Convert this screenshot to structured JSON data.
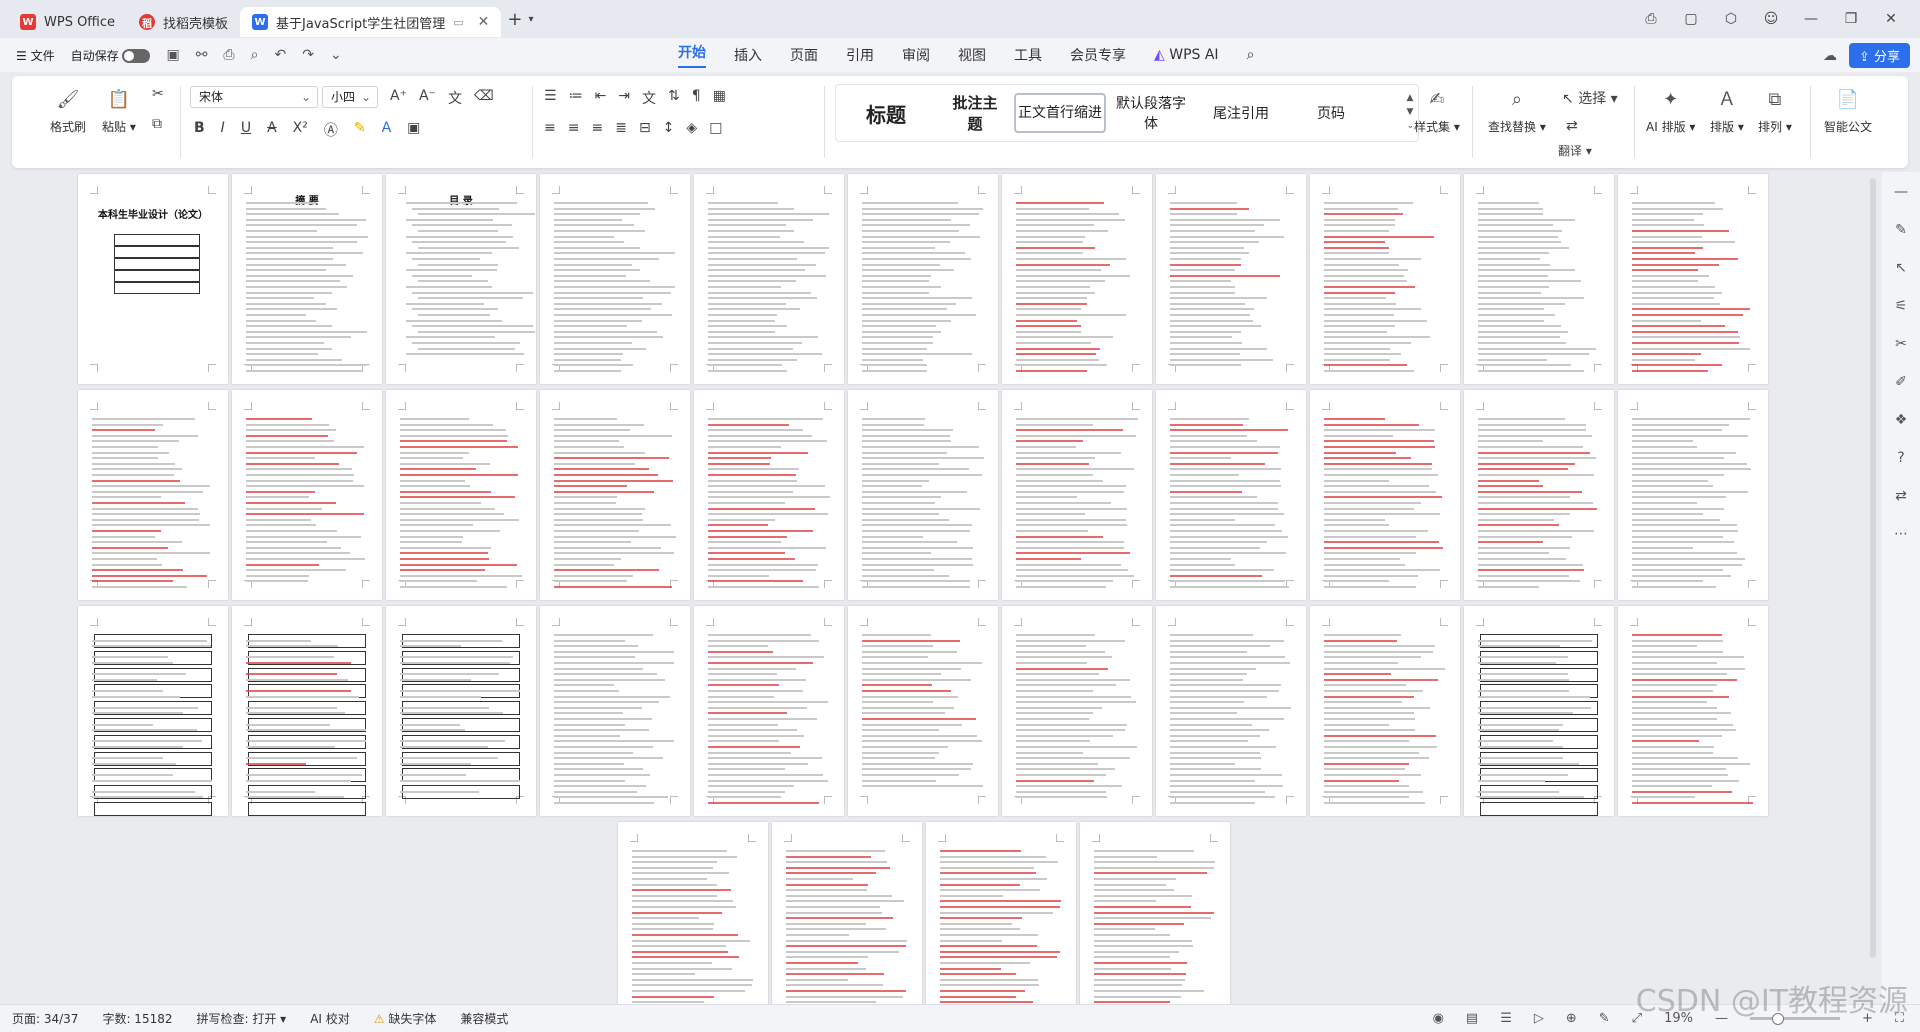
{
  "tabs": [
    {
      "label": "WPS Office",
      "icon": "wps-logo-icon"
    },
    {
      "label": "找稻壳模板",
      "icon": "docer-logo-icon"
    },
    {
      "label": "基于JavaScript学生社团管理",
      "icon": "word-doc-icon",
      "active": true
    }
  ],
  "menu": {
    "file": "文件",
    "autosave": "自动保存",
    "tabs": [
      "开始",
      "插入",
      "页面",
      "引用",
      "审阅",
      "视图",
      "工具",
      "会员专享",
      "WPS AI"
    ],
    "active_tab": "开始",
    "share": "分享"
  },
  "ribbon": {
    "format_brush": "格式刷",
    "paste": "粘贴",
    "font_name": "宋体",
    "font_size": "小四",
    "styles": [
      "标题",
      "批注主题",
      "正文首行缩进",
      "默认段落字体",
      "尾注引用",
      "页码"
    ],
    "style_set": "样式集",
    "find_replace": "查找替换",
    "select": "选择",
    "translate": "翻译",
    "ai_layout": "AI 排版",
    "layout": "排版",
    "arrange": "排列",
    "smart_doc": "智能公文"
  },
  "thumbnails": {
    "cover_title": "本科生毕业设计（论文）",
    "toc_title": "目 录",
    "abstract_title": "摘 要"
  },
  "status": {
    "page": "页面: 34/37",
    "words": "字数: 15182",
    "spell": "拼写检查: 打开",
    "ai_check": "AI 校对",
    "missing_font": "缺失字体",
    "compat": "兼容模式",
    "zoom": "19%"
  },
  "watermark": "CSDN @IT教程资源"
}
